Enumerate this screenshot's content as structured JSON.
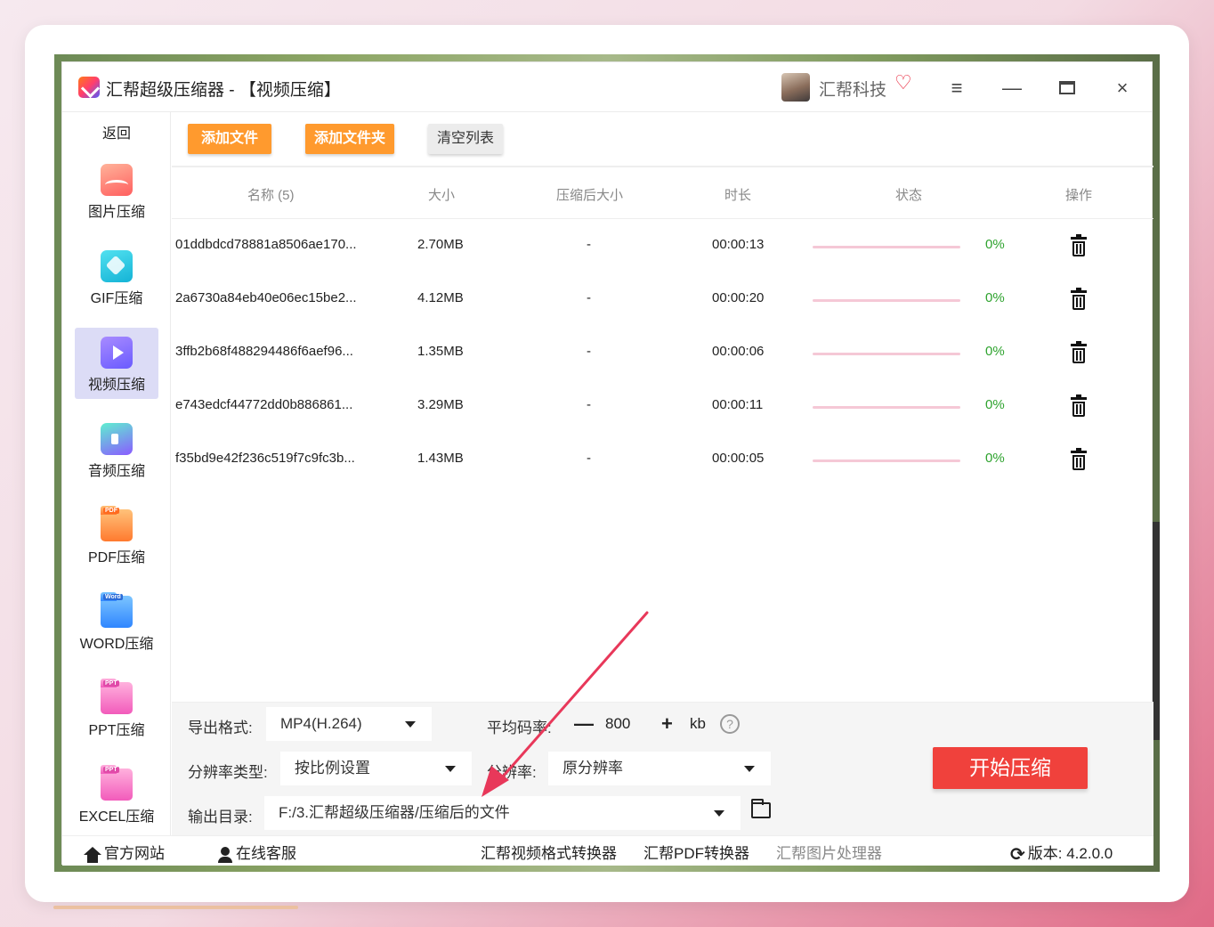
{
  "window": {
    "title": "汇帮超级压缩器  - 【视频压缩】",
    "brand_name": "汇帮科技",
    "menu_icon": "≡",
    "minimize_icon": "—",
    "close_icon": "×"
  },
  "sidebar": {
    "back_label": "返回",
    "items": [
      {
        "label": "图片压缩",
        "icon": "image-compress-icon"
      },
      {
        "label": "GIF压缩",
        "icon": "gif-compress-icon"
      },
      {
        "label": "视频压缩",
        "icon": "video-compress-icon",
        "active": true
      },
      {
        "label": "音频压缩",
        "icon": "audio-compress-icon"
      },
      {
        "label": "PDF压缩",
        "icon": "pdf-compress-icon",
        "tag": "PDF"
      },
      {
        "label": "WORD压缩",
        "icon": "word-compress-icon",
        "tag": "Word"
      },
      {
        "label": "PPT压缩",
        "icon": "ppt-compress-icon",
        "tag": "PPT"
      },
      {
        "label": "EXCEL压缩",
        "icon": "excel-compress-icon",
        "tag": "PPT"
      }
    ]
  },
  "toolbar": {
    "add_file": "添加文件",
    "add_folder": "添加文件夹",
    "clear_list": "清空列表"
  },
  "table": {
    "headers": {
      "name": "名称 (5)",
      "size": "大小",
      "compressed_size": "压缩后大小",
      "duration": "时长",
      "status": "状态",
      "action": "操作"
    },
    "rows": [
      {
        "name": "01ddbdcd78881a8506ae170...",
        "size": "2.70MB",
        "compressed_size": "-",
        "duration": "00:00:13",
        "progress": 0,
        "percent": "0%"
      },
      {
        "name": "2a6730a84eb40e06ec15be2...",
        "size": "4.12MB",
        "compressed_size": "-",
        "duration": "00:00:20",
        "progress": 0,
        "percent": "0%"
      },
      {
        "name": "3ffb2b68f488294486f6aef96...",
        "size": "1.35MB",
        "compressed_size": "-",
        "duration": "00:00:06",
        "progress": 0,
        "percent": "0%"
      },
      {
        "name": "e743edcf44772dd0b886861...",
        "size": "3.29MB",
        "compressed_size": "-",
        "duration": "00:00:11",
        "progress": 0,
        "percent": "0%"
      },
      {
        "name": "f35bd9e42f236c519f7c9fc3b...",
        "size": "1.43MB",
        "compressed_size": "-",
        "duration": "00:00:05",
        "progress": 0,
        "percent": "0%"
      }
    ]
  },
  "settings": {
    "format_label": "导出格式:",
    "format_value": "MP4(H.264)",
    "bitrate_label": "平均码率:",
    "bitrate_minus": "—",
    "bitrate_value": "800",
    "bitrate_plus": "+",
    "bitrate_unit": "kb",
    "help_icon": "?",
    "resolution_type_label": "分辨率类型:",
    "resolution_type_value": "按比例设置",
    "resolution_label": "分辨率:",
    "resolution_value": "原分辨率",
    "output_dir_label": "输出目录:",
    "output_dir_value": "F:/3.汇帮超级压缩器/压缩后的文件",
    "start_button": "开始压缩"
  },
  "footer": {
    "official_site": "官方网站",
    "online_service": "在线客服",
    "video_converter": "汇帮视频格式转换器",
    "pdf_converter": "汇帮PDF转换器",
    "image_processor": "汇帮图片处理器",
    "version": "版本:  4.2.0.0"
  },
  "colors": {
    "accent_orange": "#ff9a2e",
    "start_red": "#f0413c",
    "progress_track": "#f5c8d6",
    "percent_green": "#2ea32e",
    "active_sidebar": "#dcdcf6",
    "annotation_arrow": "#e8385a"
  }
}
